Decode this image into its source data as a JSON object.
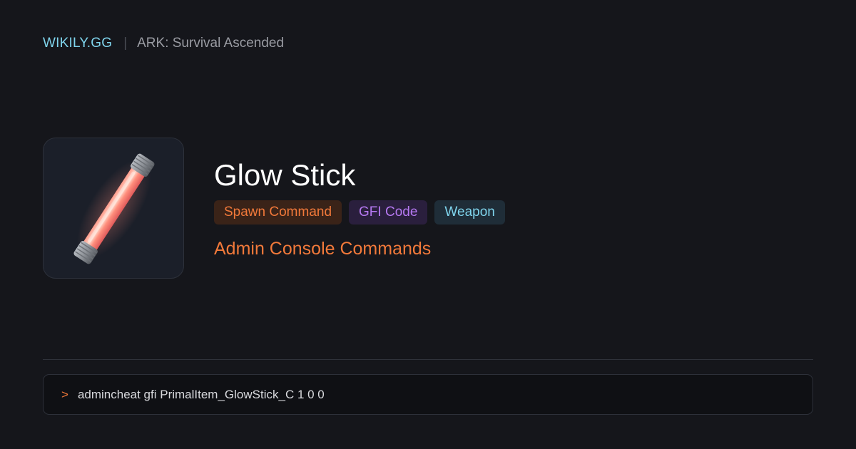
{
  "header": {
    "brand": "WIKILY.GG",
    "separator": "|",
    "game": "ARK: Survival Ascended"
  },
  "item": {
    "icon": "glow-stick-icon",
    "title": "Glow Stick",
    "tags": [
      {
        "label": "Spawn Command",
        "color": "#f2793a"
      },
      {
        "label": "GFI Code",
        "color": "#b679f2"
      },
      {
        "label": "Weapon",
        "color": "#7fd4ec"
      }
    ],
    "subtitle": "Admin Console Commands"
  },
  "console": {
    "prompt": ">",
    "command": "admincheat gfi PrimalItem_GlowStick_C 1 0 0"
  },
  "colors": {
    "background": "#15161b",
    "accent_orange": "#f2793a",
    "accent_purple": "#b679f2",
    "accent_cyan": "#7fd4ec"
  }
}
